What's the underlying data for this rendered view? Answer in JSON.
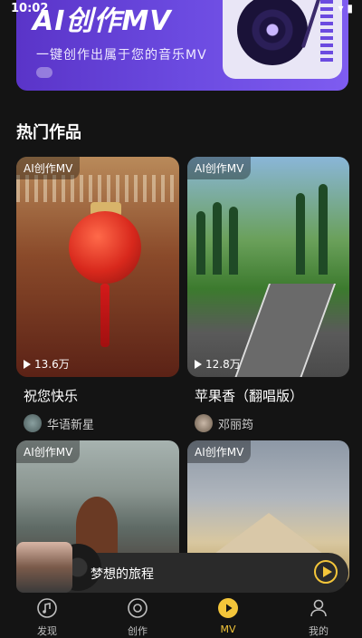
{
  "status_bar": {
    "time": "10:02",
    "right_icons": "▾ ▮"
  },
  "banner": {
    "title": "AI创作MV",
    "subtitle": "一键创作出属于您的音乐MV"
  },
  "section": {
    "title": "热门作品"
  },
  "cards": [
    {
      "badge": "AI创作MV",
      "plays": "13.6万",
      "title": "祝您快乐",
      "author": "华语新星"
    },
    {
      "badge": "AI创作MV",
      "plays": "12.8万",
      "title": "苹果香（翻唱版）",
      "author": "邓丽筠"
    },
    {
      "badge": "AI创作MV"
    },
    {
      "badge": "AI创作MV"
    }
  ],
  "player": {
    "title": "梦想的旅程"
  },
  "nav": {
    "items": [
      {
        "label": "发现",
        "icon": "music-note-icon"
      },
      {
        "label": "创作",
        "icon": "record-icon"
      },
      {
        "label": "MV",
        "icon": "play-icon"
      },
      {
        "label": "我的",
        "icon": "user-icon"
      }
    ]
  },
  "colors": {
    "accent": "#f3c53a",
    "background": "#141414",
    "banner": "#6b4ae0"
  }
}
